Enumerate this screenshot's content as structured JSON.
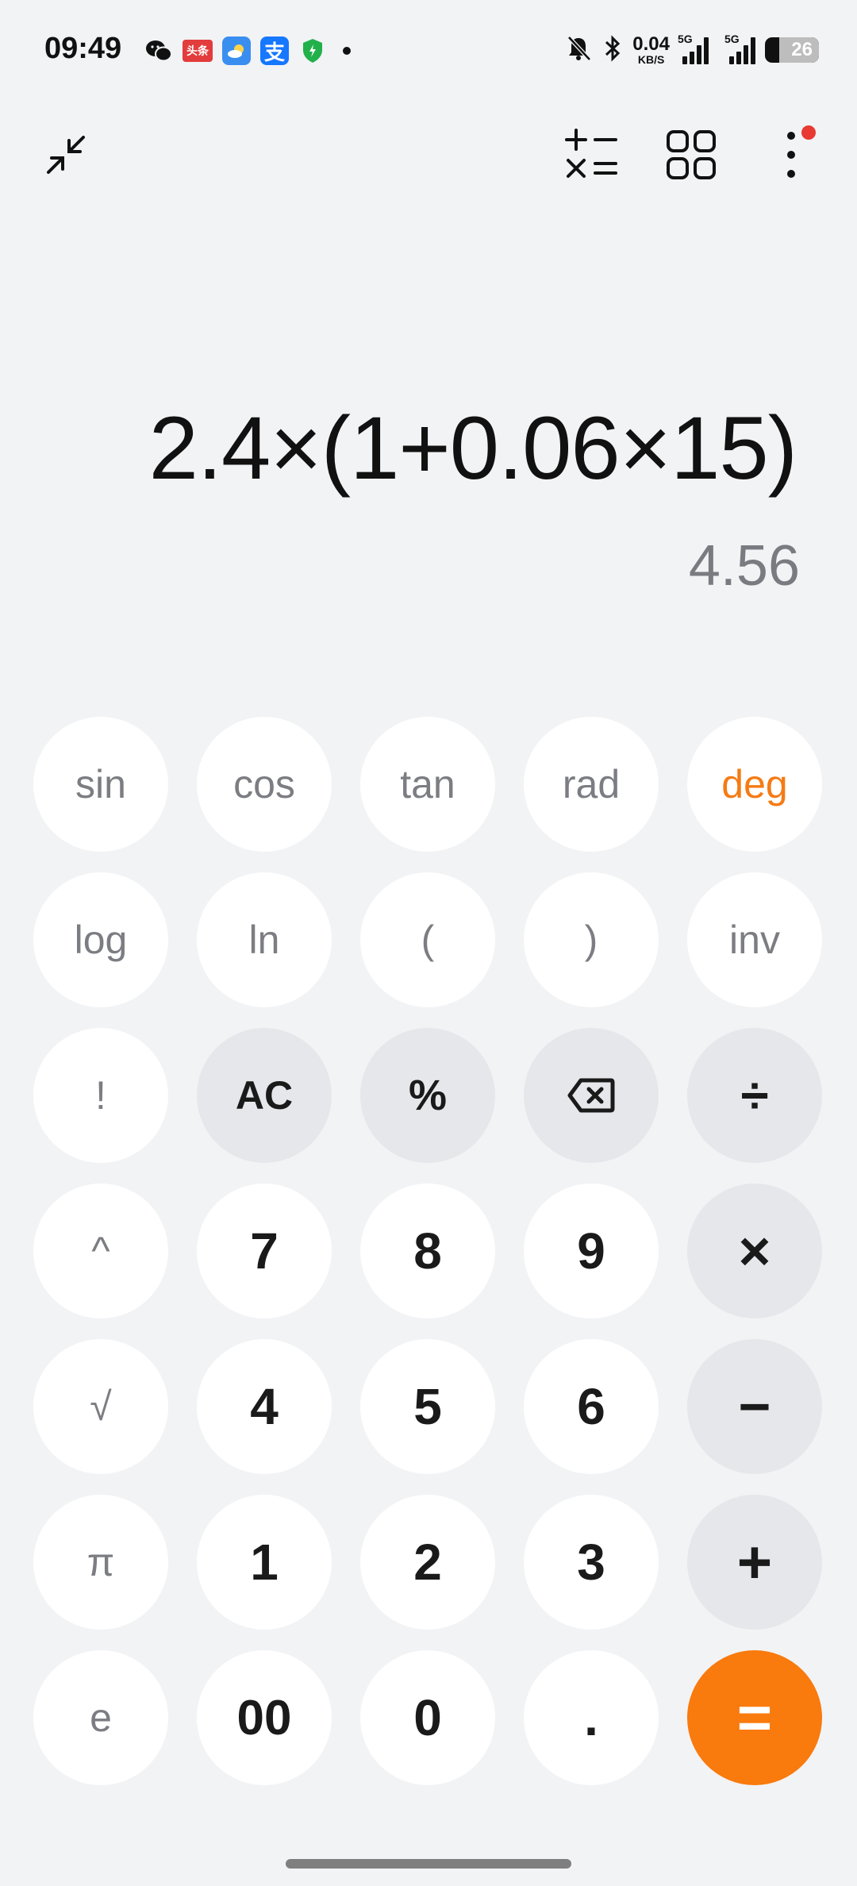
{
  "status_bar": {
    "time": "09:49",
    "net_speed_value": "0.04",
    "net_speed_unit": "KB/S",
    "sim1_label": "5G",
    "sim2_label": "5G",
    "battery_level": "26",
    "toutiao_text": "头条",
    "alipay_text": "支"
  },
  "toolbar": {
    "collapse_icon": "collapse-arrows-icon",
    "mode_icon": "calc-symbols-icon",
    "converter_icon": "grid-icon",
    "menu_icon": "more-vertical-icon",
    "badge_color": "#e83a32"
  },
  "display": {
    "expression": "2.4×(1+0.06×15)",
    "result": "4.56"
  },
  "keypad": {
    "keys": [
      {
        "label": "sin",
        "name": "key-sin"
      },
      {
        "label": "cos",
        "name": "key-cos"
      },
      {
        "label": "tan",
        "name": "key-tan"
      },
      {
        "label": "rad",
        "name": "key-rad"
      },
      {
        "label": "deg",
        "name": "key-deg"
      },
      {
        "label": "log",
        "name": "key-log"
      },
      {
        "label": "ln",
        "name": "key-ln"
      },
      {
        "label": "(",
        "name": "key-open-paren"
      },
      {
        "label": ")",
        "name": "key-close-paren"
      },
      {
        "label": "inv",
        "name": "key-inv"
      },
      {
        "label": "!",
        "name": "key-factorial"
      },
      {
        "label": "AC",
        "name": "key-all-clear"
      },
      {
        "label": "%",
        "name": "key-percent"
      },
      {
        "label": "",
        "name": "key-backspace"
      },
      {
        "label": "÷",
        "name": "key-divide"
      },
      {
        "label": "^",
        "name": "key-power"
      },
      {
        "label": "7",
        "name": "key-7"
      },
      {
        "label": "8",
        "name": "key-8"
      },
      {
        "label": "9",
        "name": "key-9"
      },
      {
        "label": "×",
        "name": "key-multiply"
      },
      {
        "label": "√",
        "name": "key-sqrt"
      },
      {
        "label": "4",
        "name": "key-4"
      },
      {
        "label": "5",
        "name": "key-5"
      },
      {
        "label": "6",
        "name": "key-6"
      },
      {
        "label": "−",
        "name": "key-minus"
      },
      {
        "label": "π",
        "name": "key-pi"
      },
      {
        "label": "1",
        "name": "key-1"
      },
      {
        "label": "2",
        "name": "key-2"
      },
      {
        "label": "3",
        "name": "key-3"
      },
      {
        "label": "+",
        "name": "key-plus"
      },
      {
        "label": "e",
        "name": "key-e"
      },
      {
        "label": "00",
        "name": "key-double-zero"
      },
      {
        "label": "0",
        "name": "key-0"
      },
      {
        "label": ".",
        "name": "key-decimal"
      },
      {
        "label": "=",
        "name": "key-equals"
      }
    ],
    "accent_color": "#f97a0d",
    "deg_color": "#f57b14"
  }
}
